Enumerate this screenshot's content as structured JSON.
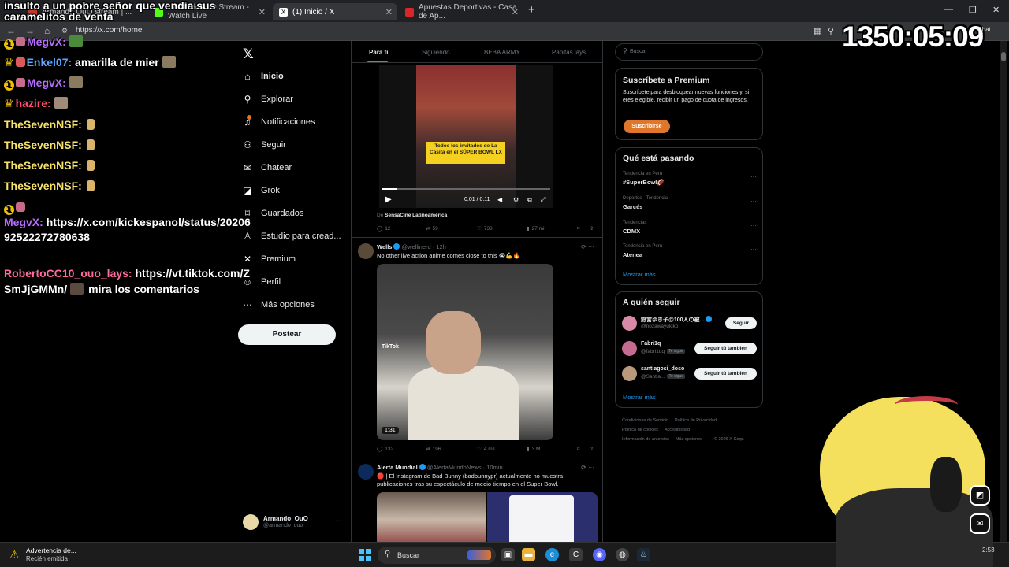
{
  "browser": {
    "tabs": [
      {
        "label": "Armando OuO stream | ...",
        "active": false,
        "color": "#c0392b"
      },
      {
        "label": "ArmandoOuO Stream - Watch Live",
        "active": false,
        "color": "#53fc18"
      },
      {
        "label": "(1) Inicio / X",
        "active": true,
        "color": "#ffffff"
      },
      {
        "label": "Apuestas Deportivas - Casa de Ap...",
        "active": false,
        "color": "#d62828"
      }
    ],
    "url": "https://x.com/home"
  },
  "overlay": {
    "title": "insulto a un pobre señor que vendia sus caramelitos de venta",
    "timer": "1350:05:09",
    "chat_label": "Chat",
    "messages": [
      {
        "user": "MegvX:",
        "text": "",
        "color": "#b86bff"
      },
      {
        "user": "Enkel07:",
        "text": "amarilla de mier",
        "color": "#5aa7ff"
      },
      {
        "user": "MegvX:",
        "text": "",
        "color": "#b86bff"
      },
      {
        "user": "hazire:",
        "text": "",
        "color": "#ff4d6d"
      },
      {
        "user": "TheSevenNSF:",
        "text": "",
        "color": "#f7e36b"
      },
      {
        "user": "TheSevenNSF:",
        "text": "",
        "color": "#f7e36b"
      },
      {
        "user": "TheSevenNSF:",
        "text": "",
        "color": "#f7e36b"
      },
      {
        "user": "TheSevenNSF:",
        "text": "",
        "color": "#f7e36b"
      },
      {
        "user": "MegvX:",
        "text": "https://x.com/kickespanol/status/20206",
        "text2": "92522272780638",
        "color": "#b86bff"
      },
      {
        "user": "RobertoCC10_ouo_lays:",
        "text": "https://vt.tiktok.com/Z",
        "text2": "SmJjGMMn/",
        "text3": "mira los comentarios",
        "color": "#ff6b9a"
      }
    ]
  },
  "x_nav": {
    "items": [
      {
        "label": "Inicio",
        "icon": "home-icon",
        "glyph": "⌂"
      },
      {
        "label": "Explorar",
        "icon": "search-icon",
        "glyph": "⚲"
      },
      {
        "label": "Notificaciones",
        "icon": "bell-icon",
        "glyph": "♫"
      },
      {
        "label": "Seguir",
        "icon": "follow-icon",
        "glyph": "⚇"
      },
      {
        "label": "Chatear",
        "icon": "mail-icon",
        "glyph": "✉"
      },
      {
        "label": "Grok",
        "icon": "grok-icon",
        "glyph": "◪"
      },
      {
        "label": "Guardados",
        "icon": "bookmark-icon",
        "glyph": "⌑"
      },
      {
        "label": "Estudio para cread...",
        "icon": "studio-icon",
        "glyph": "♙"
      },
      {
        "label": "Premium",
        "icon": "x-premium-icon",
        "glyph": "✕"
      },
      {
        "label": "Perfil",
        "icon": "profile-icon",
        "glyph": "☺"
      },
      {
        "label": "Más opciones",
        "icon": "more-icon",
        "glyph": "⋯"
      }
    ],
    "post_label": "Postear",
    "profile_name": "Armando_OuO",
    "profile_handle": "@armando_ouo"
  },
  "feed": {
    "tabs": [
      "Para ti",
      "Siguiendo",
      "BEBA ARMY",
      "Papitas lays"
    ],
    "post1": {
      "caption": "Todos los invitados de La Casita en el SÚPER BOWL LX",
      "time": "0:01 / 0:11",
      "from_prefix": "De ",
      "from_name": "SensaCine Latinoamérica",
      "replies": "12",
      "reposts": "59",
      "likes": "738",
      "views": "27 mil"
    },
    "post2": {
      "name": "Wells",
      "handle": "@wellinerd · 12h",
      "text": "No other live action anime comes close to this 😭💪🔥",
      "duration": "1:31",
      "watermark": "TikTok",
      "replies": "132",
      "reposts": "196",
      "likes": "4 mil",
      "views": "3 M"
    },
    "post3": {
      "name": "Alerta Mundial",
      "handle": "@AlertaMundoNews · 10min",
      "text": "🔴 | El Instagram de Bad Bunny (badbunnypr) actualmente no muestra publicaciones tras su espectáculo de medio tiempo en el Super Bowl."
    }
  },
  "sidebar": {
    "search_placeholder": "Buscar",
    "premium": {
      "title": "Suscríbete a Premium",
      "text": "Suscríbete para desbloquear nuevas funciones y, si eres elegible, recibir un pago de cuota de ingresos.",
      "button": "Suscribirse"
    },
    "trending": {
      "title": "Qué está pasando",
      "items": [
        {
          "context": "Tendencia en Perú",
          "name": "#SuperBowl🏈"
        },
        {
          "context": "Deportes · Tendencia",
          "name": "Garcés"
        },
        {
          "context": "Tendencias",
          "name": "CDMX"
        },
        {
          "context": "Tendencia en Perú",
          "name": "Atenea"
        }
      ],
      "show_more": "Mostrar más"
    },
    "who_to_follow": {
      "title": "A quién seguir",
      "items": [
        {
          "name": "野宮ゆき子@100人の被...",
          "handle": "@nozawayukiko",
          "tag": "",
          "button": "Seguir",
          "color": "#d88aa8"
        },
        {
          "name": "Fabri1q",
          "handle": "@fabri1qq",
          "tag": "Te sigue",
          "button": "Seguir tú también",
          "color": "#c66b90"
        },
        {
          "name": "santiagosi_doso",
          "handle": "@Santia...",
          "tag": "Te sigue",
          "button": "Seguir tú también",
          "color": "#b89a7a"
        }
      ],
      "show_more": "Mostrar más"
    },
    "footer": [
      "Condiciones de Servicio",
      "Política de Privacidad",
      "Política de cookies",
      "Accesibilidad",
      "Información de anuncios",
      "Más opciones ···",
      "© 2026 X Corp."
    ]
  },
  "taskbar": {
    "notif_title": "Advertencia de...",
    "notif_sub": "Recién emitida",
    "search_placeholder": "Buscar",
    "time": "2:53"
  }
}
